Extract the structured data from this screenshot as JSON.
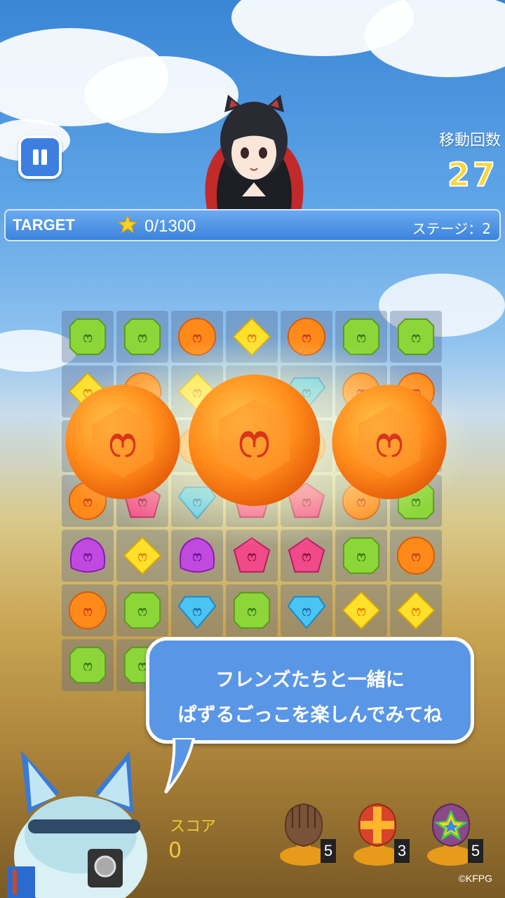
{
  "hud": {
    "moves_label": "移動回数",
    "moves_value": "27",
    "target_label": "TARGET",
    "target_progress": "0/1300",
    "stage": "ステージ：2"
  },
  "board": {
    "rows": [
      [
        "green",
        "green",
        "orange",
        "yellow",
        "orange",
        "green",
        "green"
      ],
      [
        "yellow",
        "orange",
        "yellow",
        "blue",
        "blue",
        "orange",
        "orange"
      ],
      [
        "orange",
        "orange",
        "orange",
        "orange",
        "orange",
        "orange",
        "orange"
      ],
      [
        "orange",
        "pink",
        "blue",
        "pink",
        "pink",
        "orange",
        "green"
      ],
      [
        "purple",
        "yellow",
        "purple",
        "pink",
        "pink",
        "green",
        "orange"
      ],
      [
        "orange",
        "green",
        "blue",
        "green",
        "blue",
        "yellow",
        "yellow"
      ],
      [
        "green",
        "green",
        "",
        "",
        "",
        "",
        ""
      ]
    ],
    "big_gems": [
      "orange",
      "orange",
      "orange"
    ]
  },
  "dialog": {
    "line1": "フレンズたちと一緒に",
    "line2": "ぱずるごっこを楽しんでみてね"
  },
  "score": {
    "label": "スコア",
    "value": "0"
  },
  "items": [
    {
      "name": "paw-brown-icon",
      "count": "5"
    },
    {
      "name": "paw-cross-icon",
      "count": "3"
    },
    {
      "name": "paw-rainbow-icon",
      "count": "5"
    }
  ],
  "copyright": "©KFPG"
}
